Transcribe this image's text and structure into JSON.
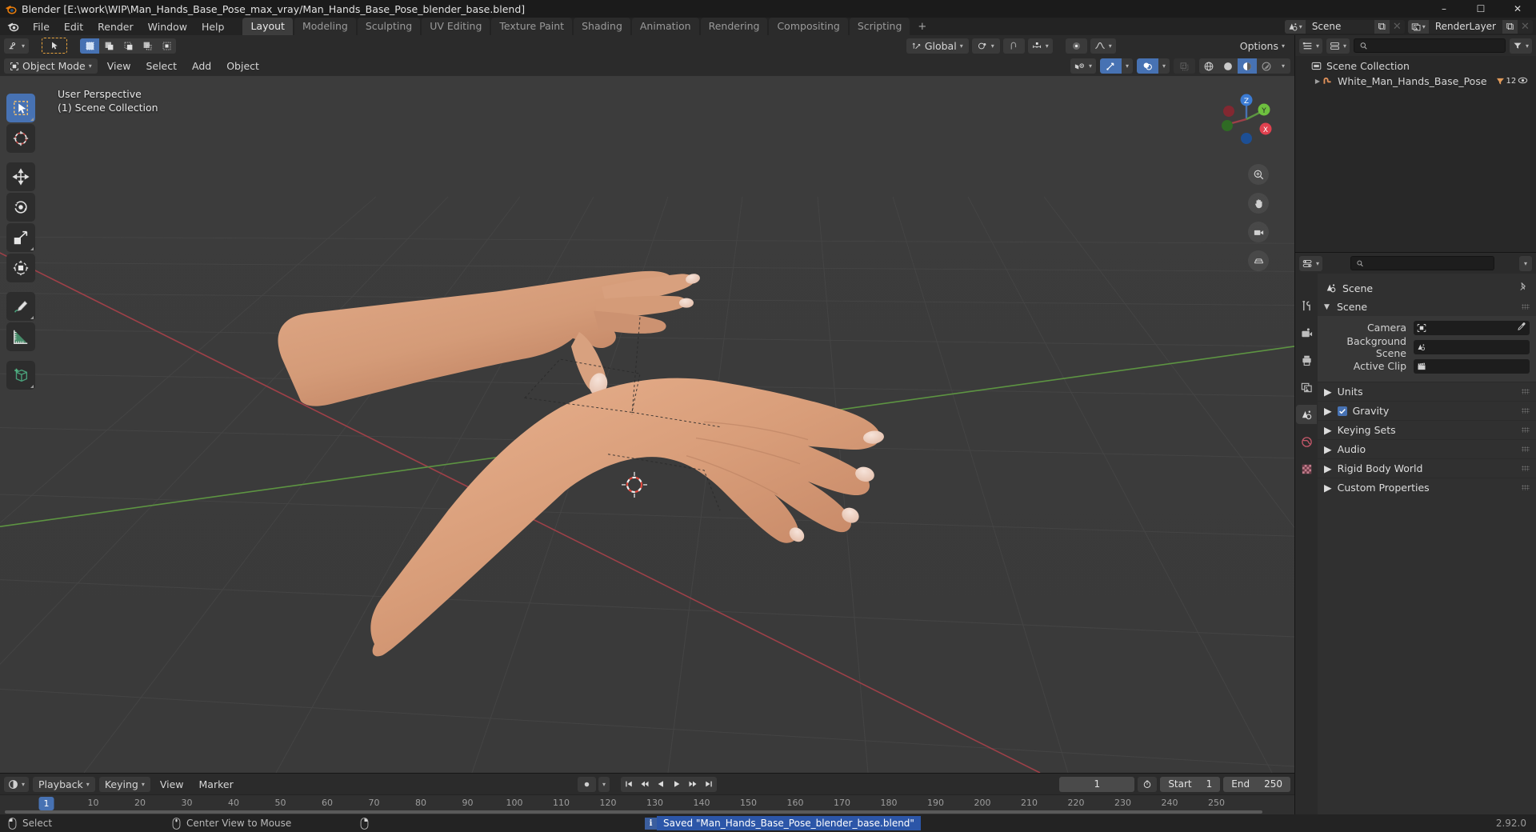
{
  "window": {
    "title": "Blender [E:\\work\\WIP\\Man_Hands_Base_Pose_max_vray/Man_Hands_Base_Pose_blender_base.blend]",
    "minimize": "–",
    "maximize": "☐",
    "close": "✕"
  },
  "menubar": {
    "items": [
      "File",
      "Edit",
      "Render",
      "Window",
      "Help"
    ]
  },
  "workspaces": {
    "tabs": [
      "Layout",
      "Modeling",
      "Sculpting",
      "UV Editing",
      "Texture Paint",
      "Shading",
      "Animation",
      "Rendering",
      "Compositing",
      "Scripting"
    ],
    "active": "Layout",
    "add_label": "+"
  },
  "topbar_right": {
    "scene": {
      "name": "Scene",
      "new_label": "⧉",
      "unlink_label": "✕"
    },
    "viewlayer": {
      "name": "RenderLayer",
      "new_label": "⧉",
      "unlink_label": "✕"
    }
  },
  "viewport_header": {
    "editor_type": "editor-type-3dview",
    "mode": "Object Mode",
    "menus": [
      "View",
      "Select",
      "Add",
      "Object"
    ],
    "transform_orientation": "Global",
    "options_label": "Options"
  },
  "viewport": {
    "perspective_label": "User Perspective",
    "collection_label": "(1) Scene Collection",
    "gizmo_axes": [
      "X",
      "Y",
      "Z"
    ],
    "tools": [
      "select-box-tool",
      "cursor-tool",
      "move-tool",
      "rotate-tool",
      "scale-tool",
      "transform-tool",
      "annotate-tool",
      "measure-tool",
      "add-cube-tool"
    ],
    "nav_buttons": [
      "zoom-icon",
      "pan-hand-icon",
      "camera-icon",
      "ortho-persp-icon"
    ]
  },
  "timeline": {
    "editor_type": "editor-type-timeline",
    "menus": [
      "Playback",
      "Keying",
      "View",
      "Marker"
    ],
    "current_frame": "1",
    "start_label": "Start",
    "start_value": "1",
    "end_label": "End",
    "end_value": "250",
    "ticks": [
      "10",
      "20",
      "30",
      "40",
      "50",
      "60",
      "70",
      "80",
      "90",
      "100",
      "110",
      "120",
      "130",
      "140",
      "150",
      "160",
      "170",
      "180",
      "190",
      "200",
      "210",
      "220",
      "230",
      "240",
      "250"
    ],
    "playhead_label": "1"
  },
  "outliner": {
    "display_mode": "view-layer",
    "filter_label": "filter-icon",
    "rows": [
      {
        "label": "Scene Collection",
        "icon": "collection-icon",
        "indent": 0,
        "expander": "",
        "badge": "",
        "eye": false
      },
      {
        "label": "White_Man_Hands_Base_Pose",
        "icon": "armature-icon",
        "indent": 1,
        "expander": "▶",
        "badge": "12",
        "eye": true
      }
    ]
  },
  "properties": {
    "search_placeholder": "",
    "tabs": [
      "tool-icon",
      "render-icon",
      "output-icon",
      "viewlayer-icon",
      "scene-icon",
      "world-icon",
      "texture-icon"
    ],
    "active_tab": "scene-icon",
    "breadcrumb": "Scene",
    "panel_title": "Scene",
    "fields": [
      {
        "label": "Camera",
        "value": "",
        "icon": "camera-data-icon",
        "eyedropper": true
      },
      {
        "label": "Background Scene",
        "value": "",
        "icon": "scene-icon",
        "eyedropper": false
      },
      {
        "label": "Active Clip",
        "value": "",
        "icon": "clip-icon",
        "eyedropper": false
      }
    ],
    "collapsed_panels": [
      {
        "label": "Units",
        "checkbox": false
      },
      {
        "label": "Gravity",
        "checkbox": true
      },
      {
        "label": "Keying Sets",
        "checkbox": false
      },
      {
        "label": "Audio",
        "checkbox": false
      },
      {
        "label": "Rigid Body World",
        "checkbox": false
      },
      {
        "label": "Custom Properties",
        "checkbox": false
      }
    ]
  },
  "statusbar": {
    "hints": [
      {
        "icon": "mouse-left-icon",
        "label": "Select"
      },
      {
        "icon": "mouse-middle-icon",
        "label": "Center View to Mouse"
      },
      {
        "icon": "mouse-right-icon",
        "label": ""
      }
    ],
    "message": "Saved \"Man_Hands_Base_Pose_blender_base.blend\"",
    "message_icon": "i",
    "version": "2.92.0"
  },
  "colors": {
    "accent": "#4772b3",
    "panel": "#303030",
    "header": "#2b2b2b",
    "viewport_bg": "#3b3b3b",
    "axis_x": "#a4414b",
    "axis_y": "#5a9c3c",
    "skin": "#d49e7e"
  }
}
